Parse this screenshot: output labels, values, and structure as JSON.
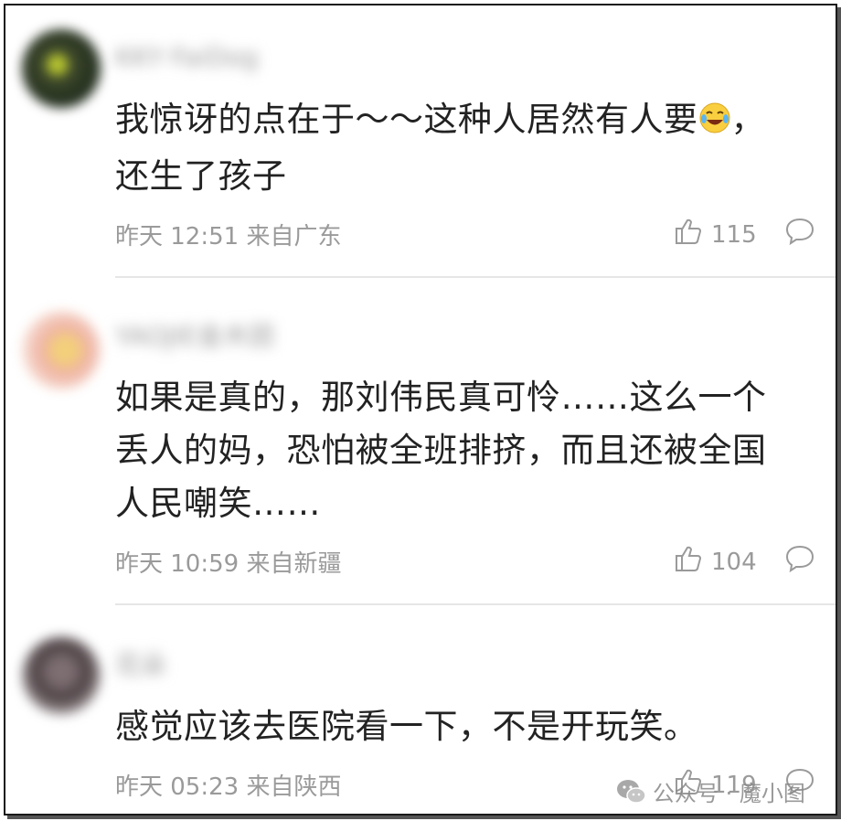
{
  "comments": [
    {
      "username": "KKY·FaiDog",
      "text_line1": "我惊讶的点在于～～这种人居然有人要",
      "text_line1_tail": "，",
      "text_line2": "还生了孩子",
      "time": "昨天 12:51 来自广东",
      "likes": "115",
      "avatar_color": "#2d3a25"
    },
    {
      "username": "YAOJIE金木团",
      "text_line1": "如果是真的，那刘伟民真可怜……这么一个",
      "text_line2": "丢人的妈，恐怕被全班排挤，而且还被全国",
      "text_line3": "人民嘲笑……",
      "time": "昨天 10:59 来自新疆",
      "likes": "104",
      "avatar_color": "#e6b58a"
    },
    {
      "username": "花朵",
      "text_line1": "感觉应该去医院看一下，不是开玩笑。",
      "time": "昨天 05:23 来自陕西",
      "likes": "119",
      "avatar_color": "#5b4f52"
    }
  ],
  "watermark": {
    "text": "公众号 · 魔小图"
  },
  "icons": {
    "like": "thumbs-up-icon",
    "reply": "speech-bubble-icon",
    "emoji": "laughing-crying-emoji",
    "wechat": "wechat-icon"
  }
}
